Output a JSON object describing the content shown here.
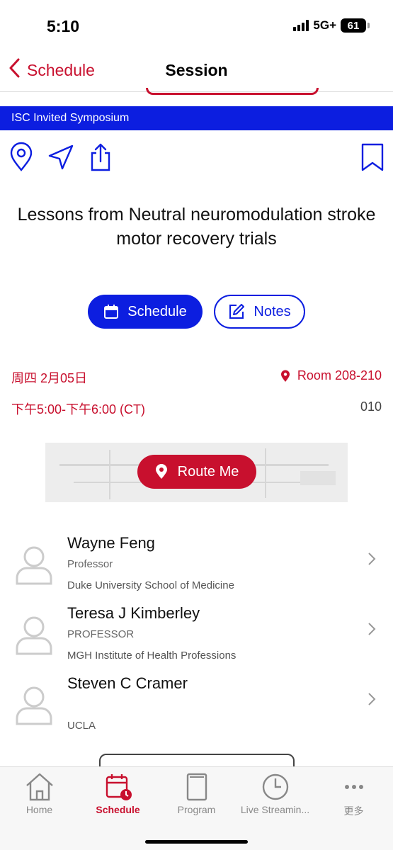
{
  "status": {
    "time": "5:10",
    "network": "5G+",
    "battery": "61"
  },
  "nav": {
    "back_label": "Schedule",
    "title": "Session"
  },
  "banner": {
    "text": "ISC Invited Symposium"
  },
  "session": {
    "title": "Lessons from Neutral neuromodulation stroke motor recovery trials"
  },
  "buttons": {
    "schedule_label": "Schedule",
    "notes_label": "Notes",
    "route_label": "Route Me"
  },
  "info": {
    "date": "周四 2月05日",
    "room": "Room 208-210",
    "time": "下午5:00-下午6:00 (CT)",
    "code": "010"
  },
  "speakers": [
    {
      "name": "Wayne Feng",
      "title": "Professor",
      "org": "Duke University School of Medicine"
    },
    {
      "name": "Teresa J Kimberley",
      "title": "PROFESSOR",
      "org": "MGH Institute of Health Professions"
    },
    {
      "name": "Steven C Cramer",
      "title": "",
      "org": "UCLA"
    }
  ],
  "tabs": [
    {
      "label": "Home",
      "icon": "home-icon"
    },
    {
      "label": "Schedule",
      "icon": "calendar-clock-icon",
      "active": true
    },
    {
      "label": "Program",
      "icon": "book-icon"
    },
    {
      "label": "Live Streamin...",
      "icon": "clock-icon"
    },
    {
      "label": "更多",
      "icon": "more-dots-icon"
    }
  ],
  "colors": {
    "accent_red": "#c8102e",
    "accent_blue": "#0c1ee0"
  }
}
